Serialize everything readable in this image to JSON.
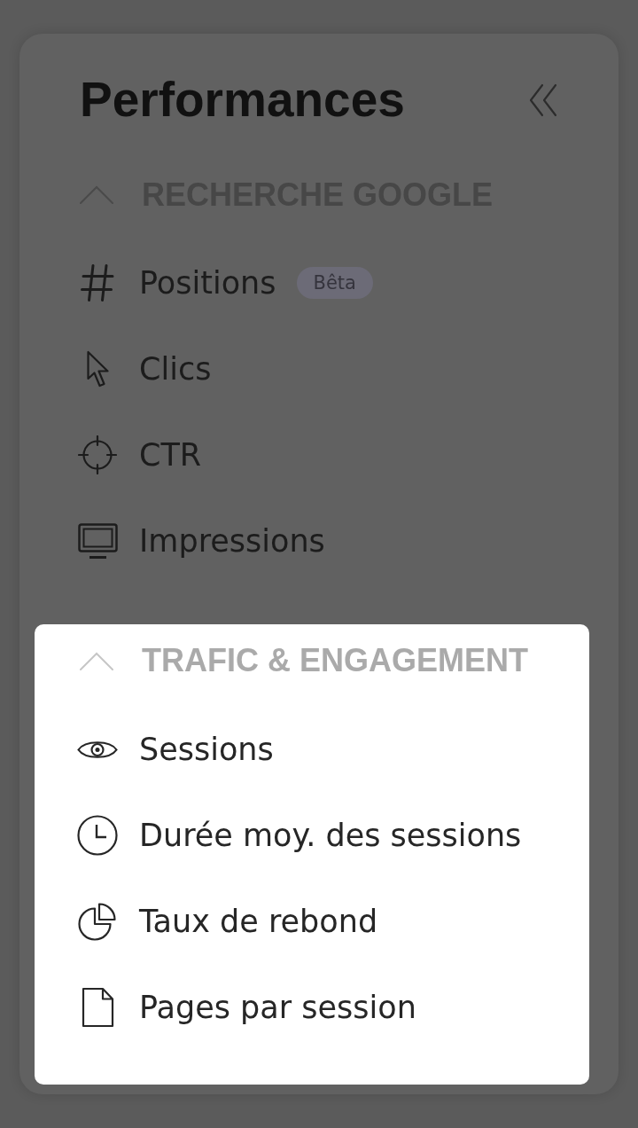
{
  "sidebar": {
    "title": "Performances",
    "sections": [
      {
        "title": "RECHERCHE GOOGLE",
        "expanded": true,
        "highlighted": false,
        "items": [
          {
            "label": "Positions",
            "badge": "Bêta"
          },
          {
            "label": "Clics"
          },
          {
            "label": "CTR"
          },
          {
            "label": "Impressions"
          }
        ]
      },
      {
        "title": "TRAFIC & ENGAGEMENT",
        "expanded": true,
        "highlighted": true,
        "items": [
          {
            "label": "Sessions"
          },
          {
            "label": "Durée moy. des sessions"
          },
          {
            "label": "Taux de rebond"
          },
          {
            "label": "Pages par session"
          }
        ]
      }
    ]
  }
}
